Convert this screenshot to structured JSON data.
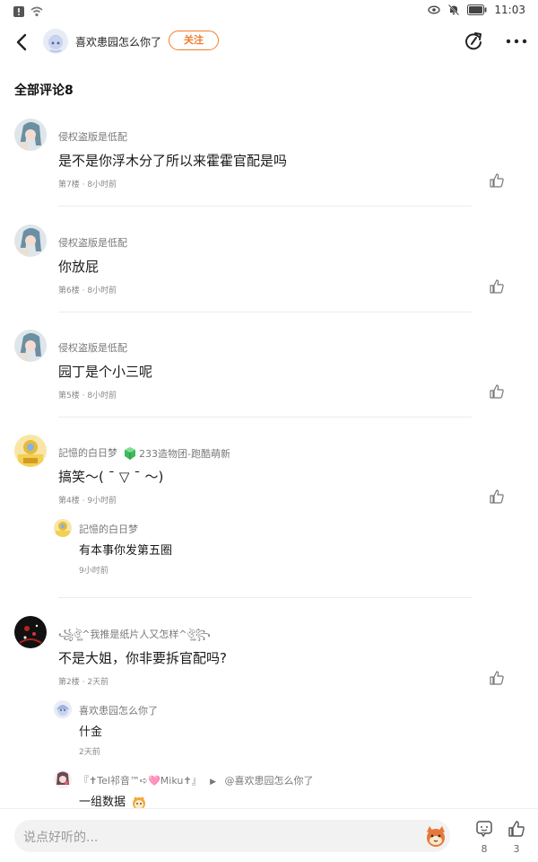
{
  "status_bar": {
    "time": "11:03"
  },
  "nav": {
    "author_name": "喜欢患园怎么你了",
    "follow_label": "关注"
  },
  "section": {
    "title": "全部评论8"
  },
  "comments": [
    {
      "name": "侵权盗版是低配",
      "text": "是不是你浮木分了所以来霍霍官配是吗",
      "floor": "第7楼",
      "time": "8小时前"
    },
    {
      "name": "侵权盗版是低配",
      "text": "你放屁",
      "floor": "第6楼",
      "time": "8小时前"
    },
    {
      "name": "侵权盗版是低配",
      "text": "园丁是个小三呢",
      "floor": "第5楼",
      "time": "8小时前"
    },
    {
      "name": "記憶的白日梦",
      "badge": "233造物团-跑酷萌新",
      "text": "搞笑～( ˉ ▽ ˉ ～)",
      "floor": "第4楼",
      "time": "9小时前",
      "reply": {
        "name": "記憶的白日梦",
        "text": "有本事你发第五圈",
        "time": "9小时前"
      }
    },
    {
      "name": "꧁ঔৣ^我推是纸片人又怎样^ঔৣ꧂",
      "text": "不是大姐，你非要拆官配吗?",
      "floor": "第2楼",
      "time": "2天前",
      "replies": [
        {
          "name": "喜欢患园怎么你了",
          "text": "什金",
          "time": "2天前"
        },
        {
          "name": "『✝Tel祁音™➪🩷Miku✝』",
          "reply_to": "@喜欢患园怎么你了",
          "text": "一组数据"
        }
      ]
    }
  ],
  "meta_sep": "·",
  "bottom": {
    "placeholder": "说点好听的...",
    "comment_count": "8",
    "like_count": "3"
  },
  "colors": {
    "accent": "#f07c2c",
    "text": "#1a1a1a",
    "muted": "#8a8a8a"
  }
}
